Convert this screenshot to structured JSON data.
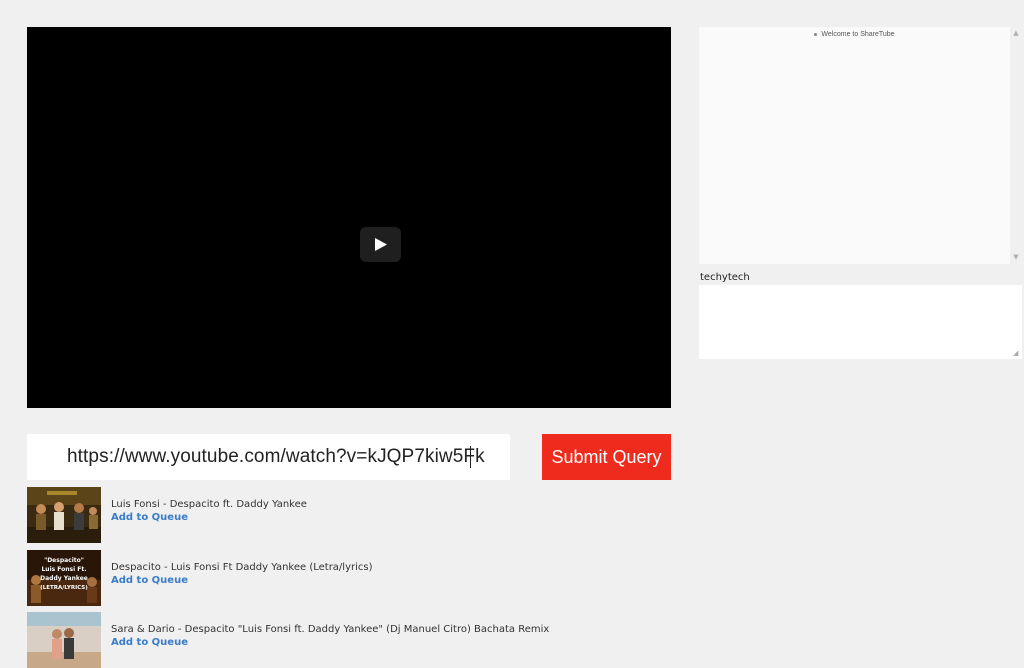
{
  "player": {
    "play_icon": "play-icon"
  },
  "chat": {
    "messages": [
      "Welcome to ShareTube"
    ],
    "username": "techytech",
    "input_value": ""
  },
  "search": {
    "url_value": "https://www.youtube.com/watch?v=kJQP7kiw5Fk",
    "submit_label": "Submit Query"
  },
  "results": [
    {
      "title": "Luis Fonsi - Despacito ft. Daddy Yankee",
      "action": "Add to Queue"
    },
    {
      "title": "Despacito - Luis Fonsi Ft Daddy Yankee (Letra/lyrics)",
      "action": "Add to Queue",
      "thumb_text": [
        "\"Despacito\"",
        "Luis Fonsi Ft.",
        "Daddy Yankee",
        "(LETRA/LYRICS)"
      ]
    },
    {
      "title": "Sara & Dario - Despacito \"Luis Fonsi ft. Daddy Yankee\" (Dj Manuel Citro) Bachata Remix",
      "action": "Add to Queue"
    }
  ],
  "colors": {
    "accent_red": "#ee2b1c",
    "link_blue": "#3a7cc9",
    "page_bg": "#f0f0f0"
  }
}
